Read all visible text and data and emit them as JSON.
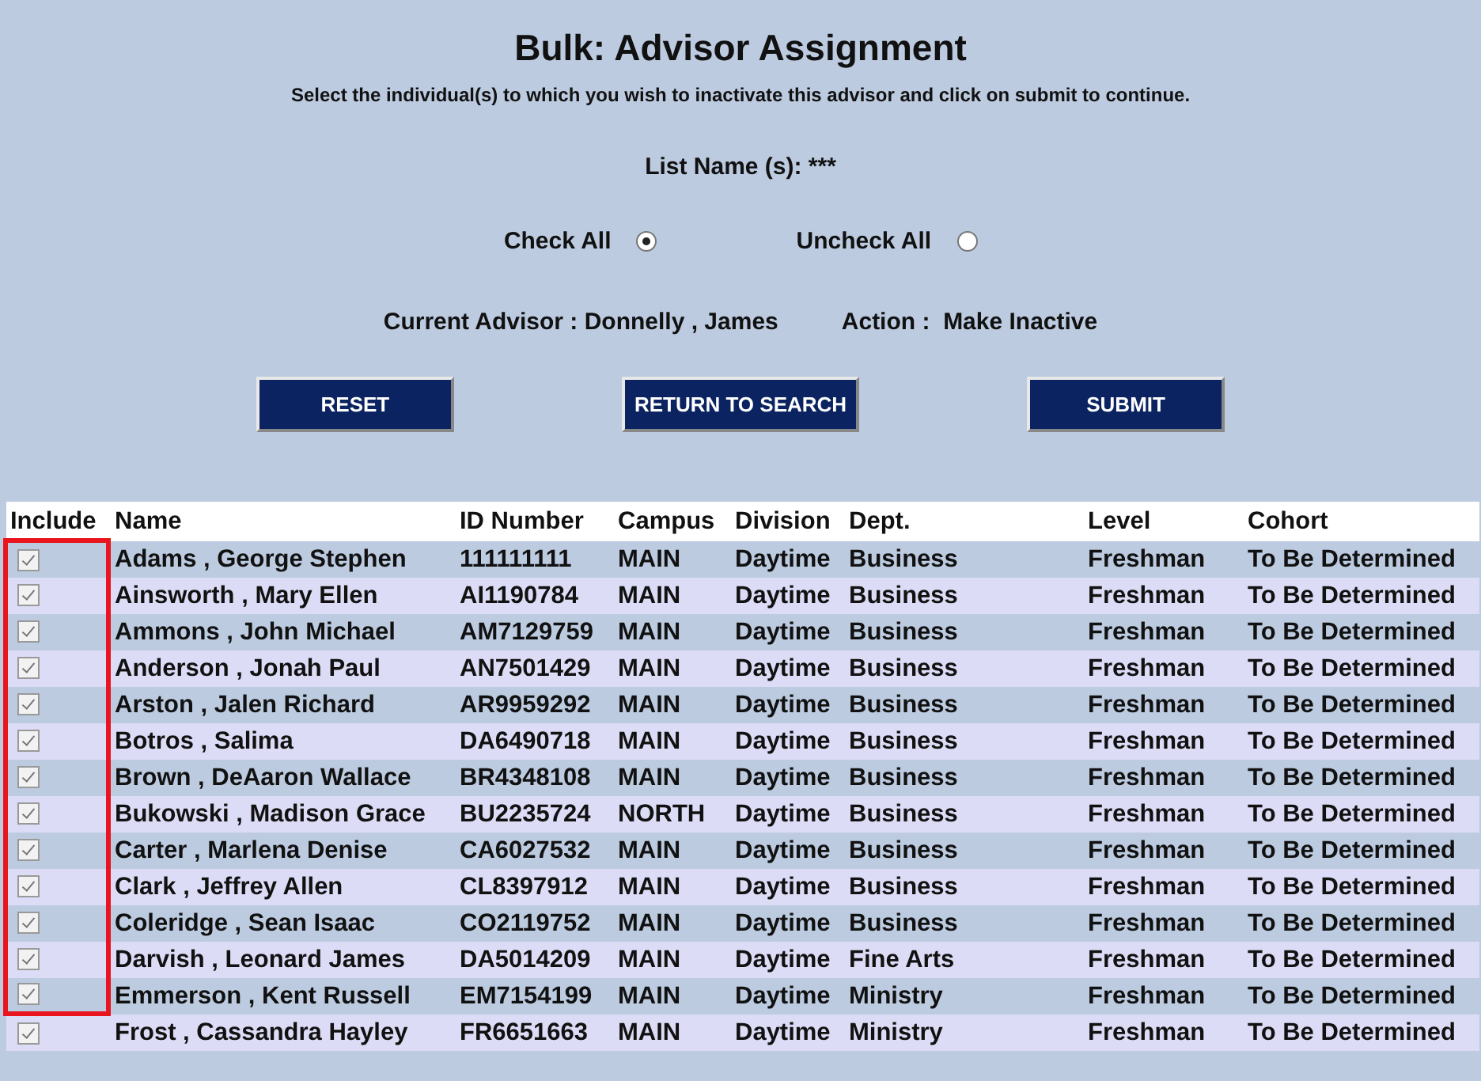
{
  "title": "Bulk: Advisor Assignment",
  "instructions": "Select the individual(s) to which you wish to inactivate this advisor and click on submit to continue.",
  "list_name": {
    "label": "List Name (s):",
    "value": "***"
  },
  "select_options": [
    {
      "label": "Check All",
      "selected": true
    },
    {
      "label": "Uncheck All",
      "selected": false
    }
  ],
  "current_advisor": {
    "label": "Current Advisor :",
    "value": "Donnelly , James"
  },
  "action": {
    "label": "Action :",
    "value": "Make Inactive"
  },
  "buttons": [
    "RESET",
    "RETURN TO SEARCH",
    "SUBMIT"
  ],
  "table": {
    "include_header": "Include",
    "columns": [
      "Name",
      "ID Number",
      "Campus",
      "Division",
      "Dept.",
      "Level",
      "Cohort"
    ],
    "rows": [
      {
        "checked": true,
        "highlighted": true,
        "cells": [
          "Adams , George Stephen",
          "111111111",
          "MAIN",
          "Daytime",
          "Business",
          "Freshman",
          "To Be Determined"
        ]
      },
      {
        "checked": true,
        "highlighted": true,
        "cells": [
          "Ainsworth , Mary Ellen",
          "AI1190784",
          "MAIN",
          "Daytime",
          "Business",
          "Freshman",
          "To Be Determined"
        ]
      },
      {
        "checked": true,
        "highlighted": true,
        "cells": [
          "Ammons , John Michael",
          "AM7129759",
          "MAIN",
          "Daytime",
          "Business",
          "Freshman",
          "To Be Determined"
        ]
      },
      {
        "checked": true,
        "highlighted": true,
        "cells": [
          "Anderson , Jonah Paul",
          "AN7501429",
          "MAIN",
          "Daytime",
          "Business",
          "Freshman",
          "To Be Determined"
        ]
      },
      {
        "checked": true,
        "highlighted": true,
        "cells": [
          "Arston , Jalen Richard",
          "AR9959292",
          "MAIN",
          "Daytime",
          "Business",
          "Freshman",
          "To Be Determined"
        ]
      },
      {
        "checked": true,
        "highlighted": true,
        "cells": [
          "Botros , Salima",
          "DA6490718",
          "MAIN",
          "Daytime",
          "Business",
          "Freshman",
          "To Be Determined"
        ]
      },
      {
        "checked": true,
        "highlighted": true,
        "cells": [
          "Brown , DeAaron Wallace",
          "BR4348108",
          "MAIN",
          "Daytime",
          "Business",
          "Freshman",
          "To Be Determined"
        ]
      },
      {
        "checked": true,
        "highlighted": true,
        "cells": [
          "Bukowski , Madison Grace",
          "BU2235724",
          "NORTH",
          "Daytime",
          "Business",
          "Freshman",
          "To Be Determined"
        ]
      },
      {
        "checked": true,
        "highlighted": true,
        "cells": [
          "Carter , Marlena Denise",
          "CA6027532",
          "MAIN",
          "Daytime",
          "Business",
          "Freshman",
          "To Be Determined"
        ]
      },
      {
        "checked": true,
        "highlighted": true,
        "cells": [
          "Clark , Jeffrey Allen",
          "CL8397912",
          "MAIN",
          "Daytime",
          "Business",
          "Freshman",
          "To Be Determined"
        ]
      },
      {
        "checked": true,
        "highlighted": true,
        "cells": [
          "Coleridge , Sean Isaac",
          "CO2119752",
          "MAIN",
          "Daytime",
          "Business",
          "Freshman",
          "To Be Determined"
        ]
      },
      {
        "checked": true,
        "highlighted": true,
        "cells": [
          "Darvish , Leonard James",
          "DA5014209",
          "MAIN",
          "Daytime",
          "Fine Arts",
          "Freshman",
          "To Be Determined"
        ]
      },
      {
        "checked": true,
        "highlighted": true,
        "cells": [
          "Emmerson , Kent Russell",
          "EM7154199",
          "MAIN",
          "Daytime",
          "Ministry",
          "Freshman",
          "To Be Determined"
        ]
      },
      {
        "checked": true,
        "highlighted": false,
        "cells": [
          "Frost , Cassandra Hayley",
          "FR6651663",
          "MAIN",
          "Daytime",
          "Ministry",
          "Freshman",
          "To Be Determined"
        ]
      }
    ]
  }
}
